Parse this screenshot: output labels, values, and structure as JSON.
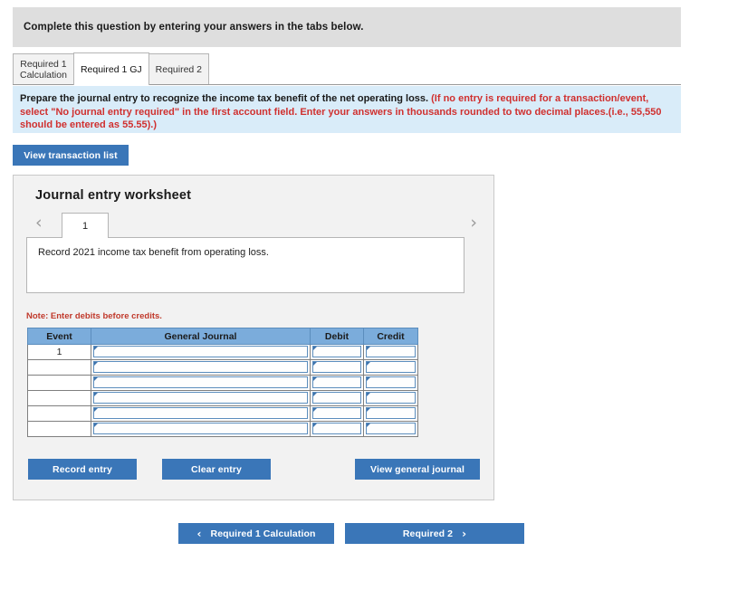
{
  "header": {
    "instruction": "Complete this question by entering your answers in the tabs below."
  },
  "tabs": [
    {
      "label": "Required 1\nCalculation",
      "active": false
    },
    {
      "label": "Required 1 GJ",
      "active": true
    },
    {
      "label": "Required 2",
      "active": false
    }
  ],
  "instruction_band": {
    "black_text": "Prepare the journal entry to recognize the income tax benefit of the net operating loss. ",
    "red_text": "(If no entry is required for a transaction/event, select \"No journal entry required\" in the first account field. Enter your answers in thousands rounded to two decimal places.(i.e., 55,550 should be entered as 55.55).)"
  },
  "toolbar": {
    "view_transaction_list": "View transaction list"
  },
  "worksheet": {
    "title": "Journal entry worksheet",
    "pager": {
      "prev_icon": "‹",
      "next_icon": "›",
      "current_entry": "1"
    },
    "description": "Record 2021 income tax benefit from operating loss.",
    "note": "Note: Enter debits before credits.",
    "table": {
      "columns": [
        "Event",
        "General Journal",
        "Debit",
        "Credit"
      ],
      "rows": [
        {
          "event": "1",
          "general_journal": "",
          "debit": "",
          "credit": ""
        },
        {
          "event": "",
          "general_journal": "",
          "debit": "",
          "credit": ""
        },
        {
          "event": "",
          "general_journal": "",
          "debit": "",
          "credit": ""
        },
        {
          "event": "",
          "general_journal": "",
          "debit": "",
          "credit": ""
        },
        {
          "event": "",
          "general_journal": "",
          "debit": "",
          "credit": ""
        },
        {
          "event": "",
          "general_journal": "",
          "debit": "",
          "credit": ""
        }
      ]
    },
    "buttons": {
      "record_entry": "Record entry",
      "clear_entry": "Clear entry",
      "view_general_journal": "View general journal"
    }
  },
  "footer": {
    "prev_icon": "‹",
    "prev_label": "Required 1 Calculation",
    "next_label": "Required 2",
    "next_icon": "›"
  },
  "colors": {
    "accent_blue": "#3a76b8",
    "band_blue": "#d9ecf9",
    "header_grey": "#dedede",
    "table_header_blue": "#7bacdb",
    "red_text": "#d0302f",
    "note_red": "#c0392b"
  }
}
